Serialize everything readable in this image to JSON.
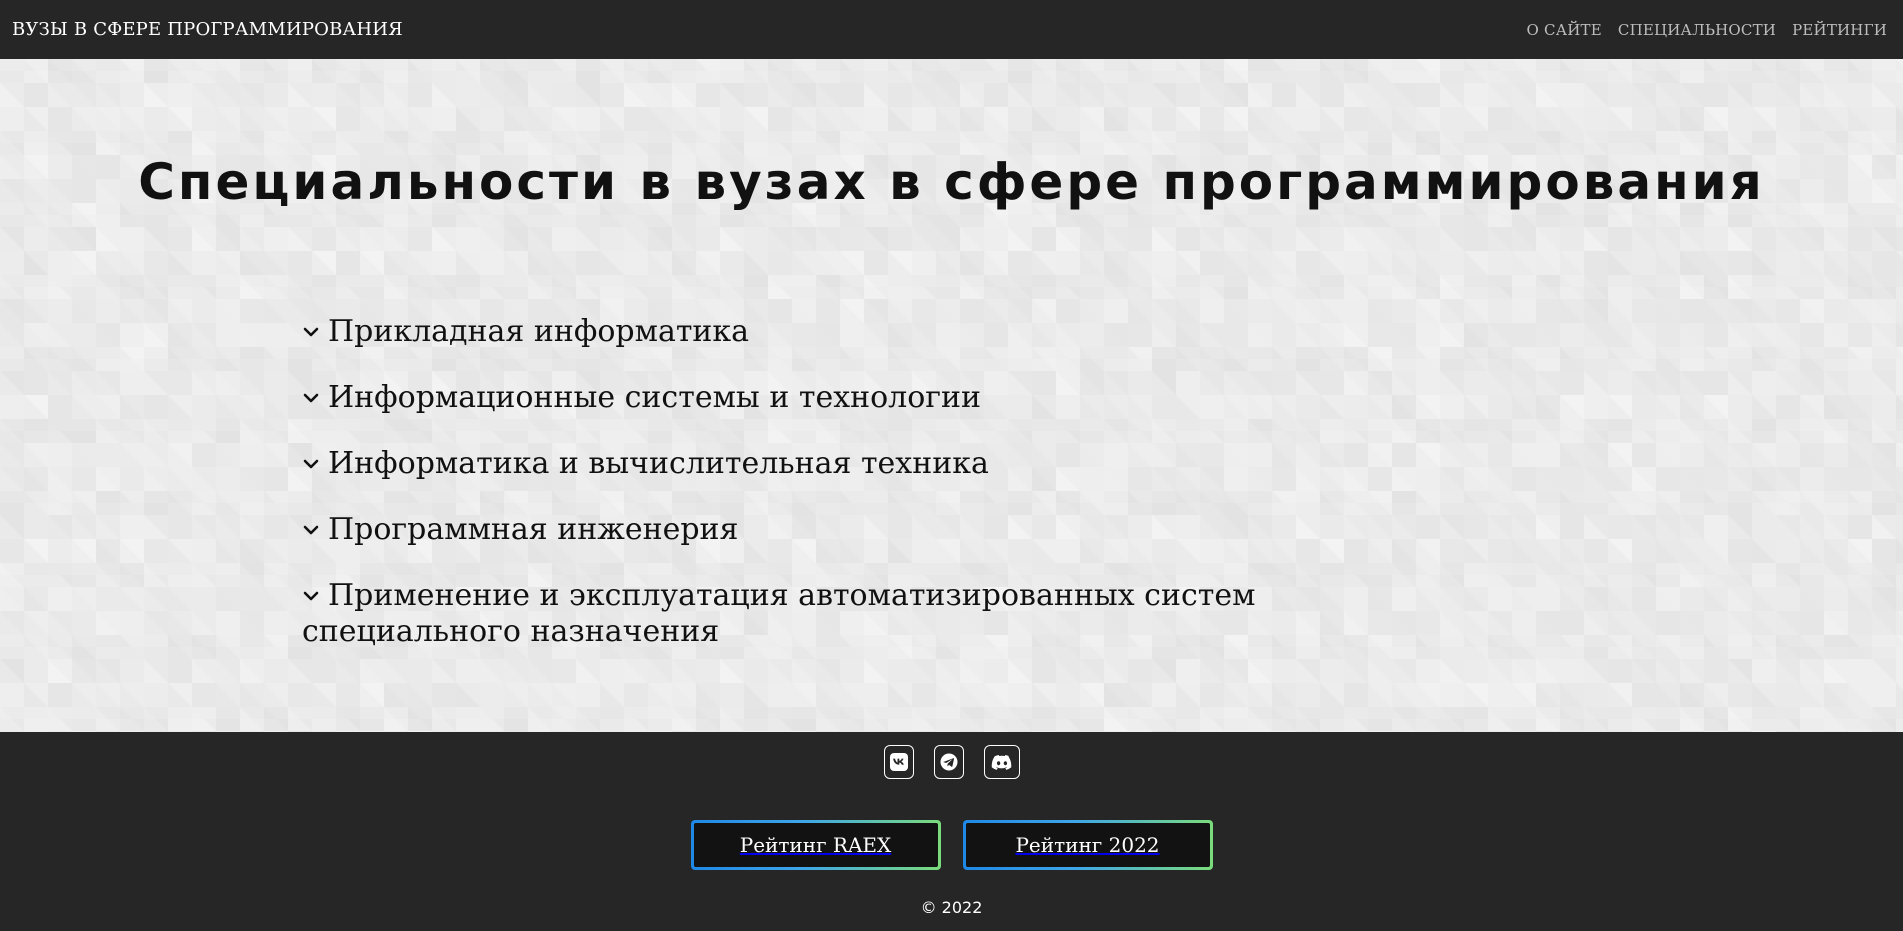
{
  "header": {
    "brand": "ВУЗЫ В СФЕРЕ ПРОГРАММИРОВАНИЯ",
    "nav": [
      {
        "label": "О САЙТЕ"
      },
      {
        "label": "СПЕЦИАЛЬНОСТИ"
      },
      {
        "label": "РЕЙТИНГИ"
      }
    ]
  },
  "main": {
    "title": "Специальности в вузах в сфере программирования",
    "specialties": [
      {
        "label": "Прикладная информатика",
        "icon": "chevron-down-icon"
      },
      {
        "label": "Информационные системы и технологии",
        "icon": "chevron-down-icon"
      },
      {
        "label": "Информатика и вычислительная техника",
        "icon": "chevron-down-icon"
      },
      {
        "label": "Программная инженерия",
        "icon": "chevron-down-icon"
      },
      {
        "label": "Применение и эксплуатация автоматизированных систем специального назначения",
        "icon": "chevron-down-icon"
      }
    ]
  },
  "footer": {
    "socials": [
      {
        "name": "vk-icon"
      },
      {
        "name": "telegram-icon"
      },
      {
        "name": "discord-icon"
      }
    ],
    "buttons": [
      {
        "label": "Рейтинг RAEX"
      },
      {
        "label": "Рейтинг 2022"
      }
    ],
    "copyright": "© 2022"
  },
  "colors": {
    "header_bg": "#262626",
    "main_bg": "#ebebeb",
    "button_gradient_start": "#1e88e5",
    "button_gradient_end": "#7bdc7b",
    "button_bg": "#121212"
  }
}
